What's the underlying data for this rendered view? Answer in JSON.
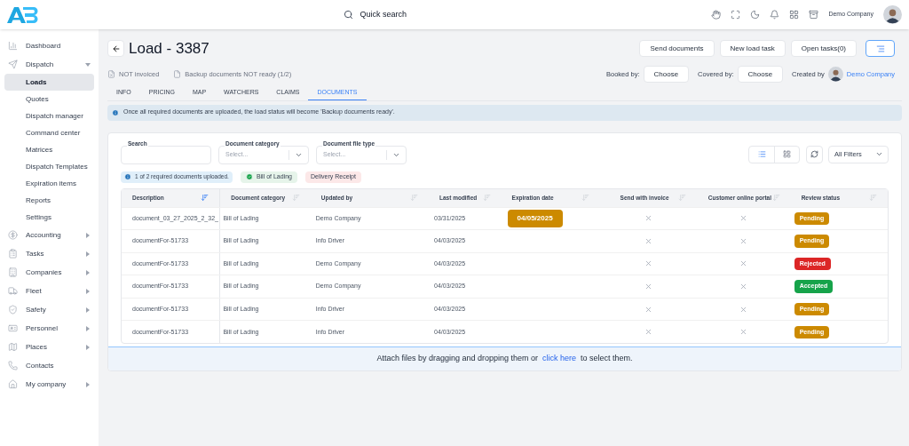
{
  "header": {
    "search_label": "Quick search",
    "user_name": "Demo Company"
  },
  "sidebar": {
    "items": [
      {
        "label": "Dashboard",
        "kind": "link",
        "selected": false
      },
      {
        "label": "Dispatch",
        "kind": "group",
        "expanded": true,
        "children": [
          {
            "label": "Loads",
            "selected": true
          },
          {
            "label": "Quotes",
            "selected": false
          },
          {
            "label": "Dispatch manager",
            "selected": false
          },
          {
            "label": "Command center",
            "selected": false
          },
          {
            "label": "Matrices",
            "selected": false
          },
          {
            "label": "Dispatch Templates",
            "selected": false
          },
          {
            "label": "Expiration items",
            "selected": false
          },
          {
            "label": "Reports",
            "selected": false
          },
          {
            "label": "Settings",
            "selected": false
          }
        ]
      },
      {
        "label": "Accounting",
        "kind": "group",
        "expanded": false
      },
      {
        "label": "Tasks",
        "kind": "group",
        "expanded": false
      },
      {
        "label": "Companies",
        "kind": "group",
        "expanded": false
      },
      {
        "label": "Fleet",
        "kind": "group",
        "expanded": false
      },
      {
        "label": "Safety",
        "kind": "group",
        "expanded": false
      },
      {
        "label": "Personnel",
        "kind": "group",
        "expanded": false
      },
      {
        "label": "Places",
        "kind": "group",
        "expanded": false
      },
      {
        "label": "Contacts",
        "kind": "link",
        "selected": false
      },
      {
        "label": "My company",
        "kind": "group",
        "expanded": false
      }
    ]
  },
  "page": {
    "title": "Load - 3387",
    "actions": [
      "Send documents",
      "New load task",
      "Open tasks(0)"
    ],
    "statuses": [
      "NOT invoiced",
      "Backup documents NOT ready (1/2)"
    ],
    "booked_by": {
      "label": "Booked by:",
      "value": "Choose"
    },
    "covered_by": {
      "label": "Covered by:",
      "value": "Choose"
    },
    "created_by": {
      "label": "Created by",
      "value": "Demo Company"
    }
  },
  "tabs": [
    {
      "label": "INFO",
      "selected": false
    },
    {
      "label": "PRICING",
      "selected": false
    },
    {
      "label": "MAP",
      "selected": false
    },
    {
      "label": "WATCHERS",
      "selected": false
    },
    {
      "label": "CLAIMS",
      "selected": false
    },
    {
      "label": "DOCUMENTS",
      "selected": true
    }
  ],
  "notice": "Once all required documents are uploaded, the load status will become 'Backup documents ready'.",
  "filters": {
    "search": {
      "label": "Search"
    },
    "category": {
      "label": "Document category",
      "placeholder": "Select..."
    },
    "file_type": {
      "label": "Document file type",
      "placeholder": "Select..."
    },
    "all_filters": "All Filters",
    "view": [
      {
        "kind": "list",
        "selected": true
      },
      {
        "kind": "grid",
        "selected": false
      }
    ]
  },
  "requirements": {
    "summary": "1 of 2 required documents uploaded.",
    "items": [
      {
        "label": "Bill of Lading",
        "uploaded": true
      },
      {
        "label": "Delivery Receipt",
        "uploaded": false
      }
    ]
  },
  "table": {
    "columns": [
      {
        "label": "Description",
        "sorted": true
      },
      {
        "label": "Document category",
        "sorted": false
      },
      {
        "label": "Updated by",
        "sorted": false
      },
      {
        "label": "Last modified",
        "sorted": false
      },
      {
        "label": "Expiration date",
        "sorted": false
      },
      {
        "label": "Send with invoice",
        "sorted": false
      },
      {
        "label": "Customer online portal",
        "sorted": false
      },
      {
        "label": "Review status",
        "sorted": false
      }
    ],
    "rows": [
      {
        "description": "document_03_27_2025_2_32_",
        "category": "Bill of Lading",
        "updated_by": "Demo Company",
        "last_modified": "03/31/2025",
        "expiration": "04/05/2025",
        "send_with_invoice": false,
        "online_portal": false,
        "status": {
          "label": "Pending",
          "kind": "pending"
        }
      },
      {
        "description": "documentFor-51733",
        "category": "Bill of Lading",
        "updated_by": "Info Driver",
        "last_modified": "04/03/2025",
        "send_with_invoice": false,
        "online_portal": false,
        "status": {
          "label": "Pending",
          "kind": "pending"
        }
      },
      {
        "description": "documentFor-51733",
        "category": "Bill of Lading",
        "updated_by": "Demo Company",
        "last_modified": "04/03/2025",
        "send_with_invoice": false,
        "online_portal": false,
        "status": {
          "label": "Rejected",
          "kind": "rejected"
        }
      },
      {
        "description": "documentFor-51733",
        "category": "Bill of Lading",
        "updated_by": "Demo Company",
        "last_modified": "04/03/2025",
        "send_with_invoice": false,
        "online_portal": false,
        "status": {
          "label": "Accepted",
          "kind": "accepted"
        }
      },
      {
        "description": "documentFor-51733",
        "category": "Bill of Lading",
        "updated_by": "Info Driver",
        "last_modified": "04/03/2025",
        "send_with_invoice": false,
        "online_portal": false,
        "status": {
          "label": "Pending",
          "kind": "pending"
        }
      },
      {
        "description": "documentFor-51733",
        "category": "Bill of Lading",
        "updated_by": "Info Driver",
        "last_modified": "04/03/2025",
        "send_with_invoice": false,
        "online_portal": false,
        "status": {
          "label": "Pending",
          "kind": "pending"
        }
      }
    ]
  },
  "dropzone": {
    "before": "Attach files by dragging and dropping them or",
    "link": "click here",
    "after": "to select them."
  }
}
